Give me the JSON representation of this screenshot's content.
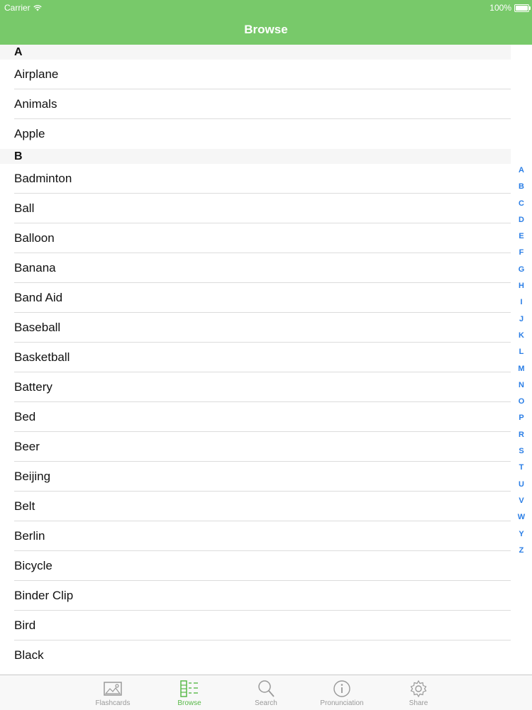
{
  "status": {
    "carrier": "Carrier",
    "battery": "100%"
  },
  "header": {
    "title": "Browse"
  },
  "sections": [
    {
      "letter": "A",
      "items": [
        "Airplane",
        "Animals",
        "Apple"
      ]
    },
    {
      "letter": "B",
      "items": [
        "Badminton",
        "Ball",
        "Balloon",
        "Banana",
        "Band Aid",
        "Baseball",
        "Basketball",
        "Battery",
        "Bed",
        "Beer",
        "Beijing",
        "Belt",
        "Berlin",
        "Bicycle",
        "Binder Clip",
        "Bird",
        "Black"
      ]
    }
  ],
  "index_letters": [
    "A",
    "B",
    "C",
    "D",
    "E",
    "F",
    "G",
    "H",
    "I",
    "J",
    "K",
    "L",
    "M",
    "N",
    "O",
    "P",
    "R",
    "S",
    "T",
    "U",
    "V",
    "W",
    "Y",
    "Z"
  ],
  "tabs": [
    {
      "label": "Flashcards",
      "icon": "image-icon",
      "active": false
    },
    {
      "label": "Browse",
      "icon": "list-icon",
      "active": true
    },
    {
      "label": "Search",
      "icon": "search-icon",
      "active": false
    },
    {
      "label": "Pronunciation",
      "icon": "info-icon",
      "active": false
    },
    {
      "label": "Share",
      "icon": "gear-icon",
      "active": false
    }
  ],
  "colors": {
    "accent": "#78c96a",
    "index": "#2a7ee6",
    "active_tab": "#58b948"
  }
}
